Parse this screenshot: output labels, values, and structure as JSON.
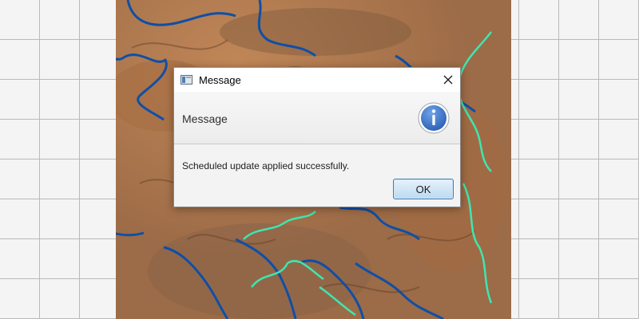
{
  "dialog": {
    "title": "Message",
    "header_text": "Message",
    "content_text": "Scheduled update applied successfully.",
    "ok_label": "OK",
    "icons": {
      "window": "application-window-icon",
      "close": "close-icon",
      "info": "information-icon"
    }
  },
  "colors": {
    "accent": "#3f76c6",
    "route_primary": "#0f4fa6",
    "route_secondary": "#3ee6b0",
    "terrain": "#b07443"
  }
}
